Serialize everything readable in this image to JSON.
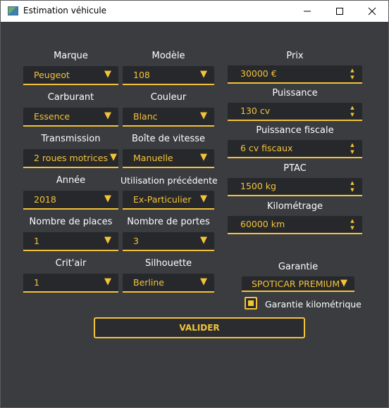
{
  "window": {
    "title": "Estimation véhicule"
  },
  "icons": {
    "minimize": "minimize-icon",
    "maximize": "maximize-icon",
    "close": "close-icon",
    "dropdown": "triangle-down-icon",
    "spin": "spin-arrows-icon"
  },
  "colors": {
    "accent": "#f5c338",
    "background": "#3a3c40",
    "field": "#26282b"
  },
  "form": {
    "marque": {
      "label": "Marque",
      "value": "Peugeot"
    },
    "modele": {
      "label": "Modèle",
      "value": "108"
    },
    "carburant": {
      "label": "Carburant",
      "value": "Essence"
    },
    "couleur": {
      "label": "Couleur",
      "value": "Blanc"
    },
    "transmission": {
      "label": "Transmission",
      "value": "2 roues motrices"
    },
    "boite": {
      "label": "Boîte de vitesse",
      "value": "Manuelle"
    },
    "annee": {
      "label": "Année",
      "value": "2018"
    },
    "utilisation": {
      "label": "Utilisation précédente",
      "value": "Ex-Particulier"
    },
    "places": {
      "label": "Nombre de places",
      "value": "1"
    },
    "portes": {
      "label": "Nombre de portes",
      "value": "3"
    },
    "critair": {
      "label": "Crit'air",
      "value": "1"
    },
    "silhouette": {
      "label": "Silhouette",
      "value": "Berline"
    },
    "prix": {
      "label": "Prix",
      "value": "30000 €"
    },
    "puissance": {
      "label": "Puissance",
      "value": "130 cv"
    },
    "puissance_fiscale": {
      "label": "Puissance fiscale",
      "value": "6 cv fiscaux"
    },
    "ptac": {
      "label": "PTAC",
      "value": "1500 kg"
    },
    "kilometrage": {
      "label": "Kilométrage",
      "value": "60000 km"
    },
    "garantie": {
      "label": "Garantie",
      "value": "SPOTICAR PREMIUM"
    },
    "garantie_km": {
      "label": "Garantie kilométrique",
      "checked": true
    }
  },
  "actions": {
    "valider": "VALIDER"
  }
}
